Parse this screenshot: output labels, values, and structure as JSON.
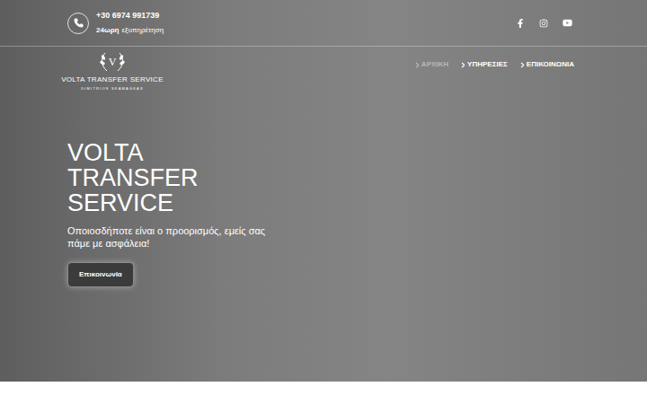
{
  "topbar": {
    "phone": "+30 6974 991739",
    "hours": {
      "bold": "24ωρη",
      "text": "εξυπηρέτηση"
    }
  },
  "logo": {
    "mark": "V",
    "name": "VOLTA TRANSFER SERVICE",
    "sub": "DIMITRIOS SKAMAGKAS"
  },
  "nav": [
    {
      "label": "ΑΡΧΙΚΗ",
      "selected": true
    },
    {
      "label": "ΥΠΗΡΕΣΙΕΣ",
      "selected": false
    },
    {
      "label": "ΕΠΙΚΟΙΝΩΝΙΑ",
      "selected": false
    }
  ],
  "hero": {
    "title": "VOLTA TRANSFER SERVICE",
    "subtitle": "Οποιοσδήποτε είναι ο προορισμός, εμείς σας πάμε με ασφάλεια!",
    "button": "Επικοινωνία"
  }
}
